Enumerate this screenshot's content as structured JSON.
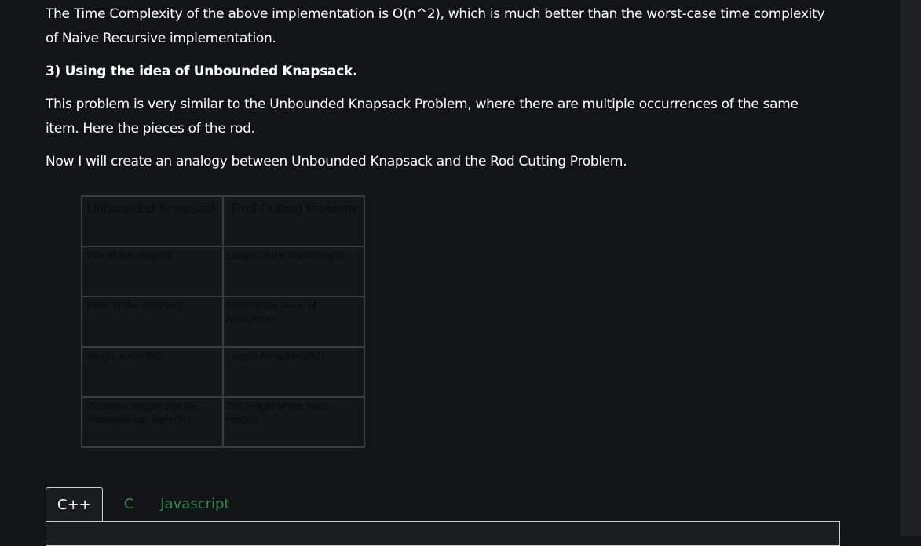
{
  "paragraphs": {
    "p1": "The Time Complexity of the above implementation is O(n^2), which is much better than the worst-case time complexity of Naive Recursive implementation.",
    "heading": "3) Using the idea of Unbounded Knapsack.",
    "p2": "This problem is very similar to the Unbounded Knapsack Problem, where there are multiple occurrences of the same item. Here the pieces of the rod.",
    "p3": "Now I will create an analogy between Unbounded Knapsack and the Rod Cutting Problem."
  },
  "table": {
    "headers": [
      "Unbounded Knapsack",
      "Rod Cutting Problem"
    ],
    "rows": [
      [
        "Size of the array(N)",
        "Length of the Rod(Length)"
      ],
      [
        "Value of the item(Val)",
        "Price of the piece of Rod(price)"
      ],
      [
        "Weight array(W[])",
        "Length Array(length[])"
      ],
      [
        "Maximum weight that the Knapsack can have(W)",
        "The length of the main rod(W)"
      ]
    ]
  },
  "tabs": [
    "C++",
    "C",
    "Javascript"
  ]
}
